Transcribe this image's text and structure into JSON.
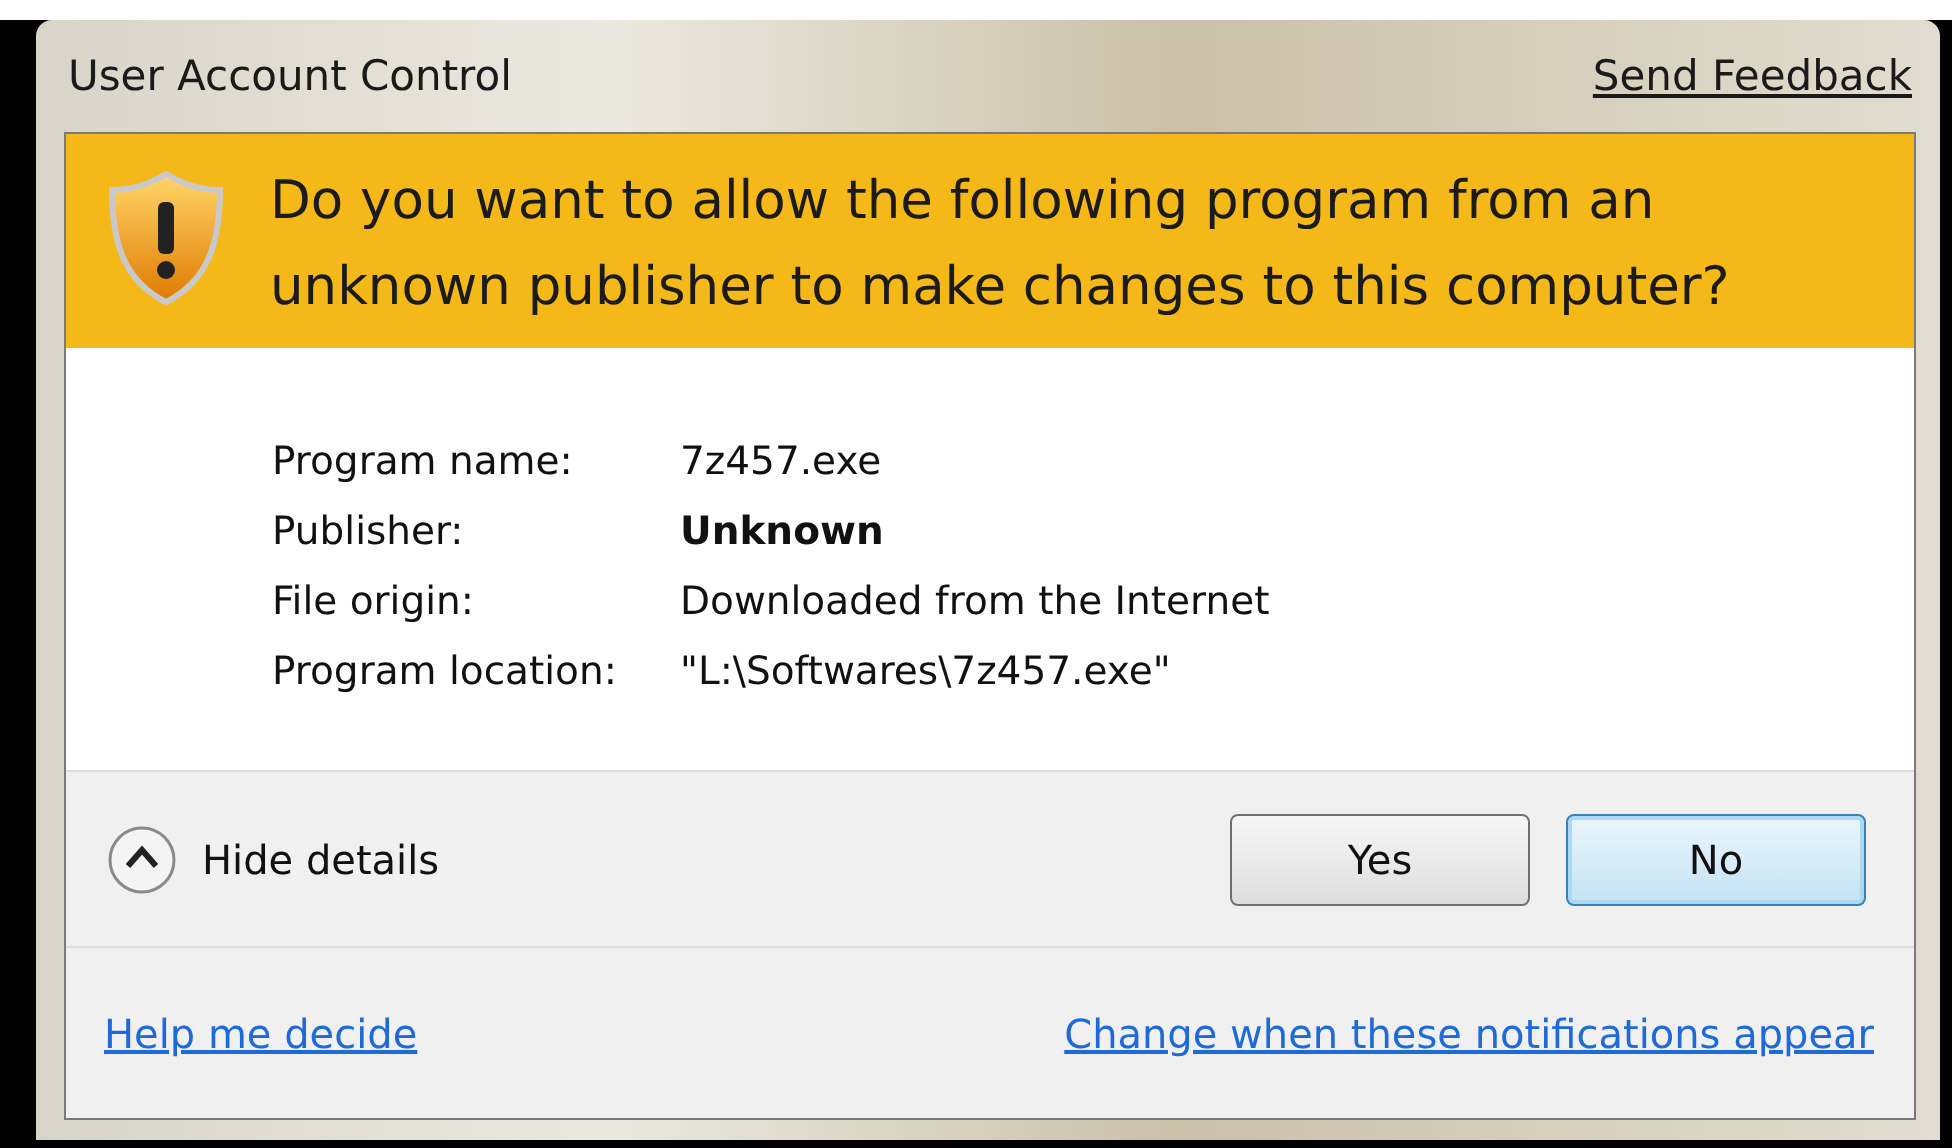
{
  "window": {
    "title": "User Account Control",
    "feedback_link": "Send Feedback"
  },
  "heading": "Do you want to allow the following program from an unknown publisher to make changes to this computer?",
  "details": [
    {
      "label": "Program name:",
      "value": "7z457.exe",
      "emphasis": false
    },
    {
      "label": "Publisher:",
      "value": "Unknown",
      "emphasis": true
    },
    {
      "label": "File origin:",
      "value": "Downloaded from the Internet",
      "emphasis": false
    },
    {
      "label": "Program location:",
      "value": "\"L:\\Softwares\\7z457.exe\"",
      "emphasis": false
    }
  ],
  "details_toggle": {
    "label": "Hide details",
    "expanded": true
  },
  "buttons": [
    {
      "label": "Yes",
      "default": false
    },
    {
      "label": "No",
      "default": true
    }
  ],
  "links": [
    "Help me decide",
    "Change when these notifications appear"
  ]
}
